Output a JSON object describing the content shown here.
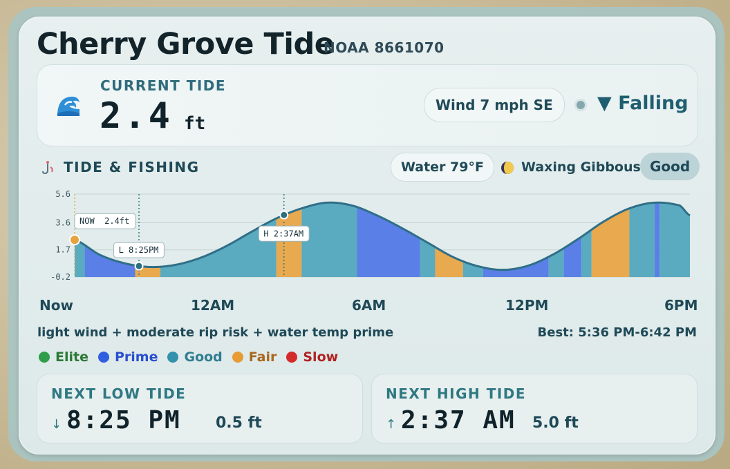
{
  "header": {
    "title": "Cherry Grove Tide",
    "station": "NOAA 8661070"
  },
  "current": {
    "label": "CURRENT TIDE",
    "value": "2.4",
    "unit": "ft",
    "wind": "Wind 7 mph SE",
    "trend": "▼ Falling"
  },
  "fishing": {
    "label": "TIDE & FISHING",
    "water": "Water 79°F",
    "moon": "Waxing Gibbous",
    "rating": "Good",
    "note": "light wind + moderate rip risk + water temp prime",
    "best": "Best: 5:36 PM-6:42 PM"
  },
  "legend": [
    {
      "label": "Elite",
      "color": "#2e9e4a"
    },
    {
      "label": "Prime",
      "color": "#2f5fe0"
    },
    {
      "label": "Good",
      "color": "#3391ab"
    },
    {
      "label": "Fair",
      "color": "#e69b34"
    },
    {
      "label": "Slow",
      "color": "#d22b2b"
    }
  ],
  "chart_data": {
    "type": "area",
    "y_ticks": [
      "5.6",
      "3.6",
      "1.7",
      "-0.2"
    ],
    "ylim": [
      -0.2,
      5.6
    ],
    "x_ticks": [
      {
        "label": "Now",
        "hours": 0
      },
      {
        "label": "12AM",
        "hours": 5.8
      },
      {
        "label": "6AM",
        "hours": 11.8
      },
      {
        "label": "12PM",
        "hours": 17.8
      },
      {
        "label": "6PM",
        "hours": 23.8
      }
    ],
    "xlim_hours": [
      0,
      24.4
    ],
    "tide_curve": [
      {
        "hours": 0.0,
        "ft": 2.4
      },
      {
        "hours": 1.0,
        "ft": 1.35
      },
      {
        "hours": 2.0,
        "ft": 0.75
      },
      {
        "hours": 3.0,
        "ft": 0.5
      },
      {
        "hours": 4.0,
        "ft": 0.65
      },
      {
        "hours": 5.0,
        "ft": 1.15
      },
      {
        "hours": 6.0,
        "ft": 1.95
      },
      {
        "hours": 7.0,
        "ft": 2.95
      },
      {
        "hours": 8.0,
        "ft": 3.9
      },
      {
        "hours": 9.0,
        "ft": 4.6
      },
      {
        "hours": 10.0,
        "ft": 5.0
      },
      {
        "hours": 11.0,
        "ft": 4.8
      },
      {
        "hours": 12.0,
        "ft": 4.1
      },
      {
        "hours": 13.0,
        "ft": 3.2
      },
      {
        "hours": 14.0,
        "ft": 2.2
      },
      {
        "hours": 15.0,
        "ft": 1.2
      },
      {
        "hours": 16.0,
        "ft": 0.55
      },
      {
        "hours": 17.0,
        "ft": 0.3
      },
      {
        "hours": 18.0,
        "ft": 0.6
      },
      {
        "hours": 19.0,
        "ft": 1.4
      },
      {
        "hours": 20.0,
        "ft": 2.5
      },
      {
        "hours": 21.0,
        "ft": 3.7
      },
      {
        "hours": 22.0,
        "ft": 4.6
      },
      {
        "hours": 23.0,
        "ft": 5.0
      },
      {
        "hours": 24.0,
        "ft": 4.8
      },
      {
        "hours": 24.4,
        "ft": 4.1
      }
    ],
    "rating_bands": [
      {
        "from": 0.0,
        "to": 0.4,
        "rating": "Good"
      },
      {
        "from": 0.4,
        "to": 2.4,
        "rating": "Prime"
      },
      {
        "from": 2.4,
        "to": 3.4,
        "rating": "Fair"
      },
      {
        "from": 3.4,
        "to": 8.0,
        "rating": "Good"
      },
      {
        "from": 8.0,
        "to": 9.0,
        "rating": "Fair"
      },
      {
        "from": 9.0,
        "to": 11.2,
        "rating": "Good"
      },
      {
        "from": 11.2,
        "to": 13.7,
        "rating": "Prime"
      },
      {
        "from": 13.7,
        "to": 14.3,
        "rating": "Good"
      },
      {
        "from": 14.3,
        "to": 15.4,
        "rating": "Fair"
      },
      {
        "from": 15.4,
        "to": 16.2,
        "rating": "Good"
      },
      {
        "from": 16.2,
        "to": 18.8,
        "rating": "Prime"
      },
      {
        "from": 18.8,
        "to": 19.4,
        "rating": "Good"
      },
      {
        "from": 19.4,
        "to": 20.1,
        "rating": "Prime"
      },
      {
        "from": 20.1,
        "to": 20.5,
        "rating": "Good"
      },
      {
        "from": 20.5,
        "to": 22.0,
        "rating": "Fair"
      },
      {
        "from": 22.0,
        "to": 23.0,
        "rating": "Good"
      },
      {
        "from": 23.0,
        "to": 23.2,
        "rating": "Prime"
      },
      {
        "from": 23.2,
        "to": 24.4,
        "rating": "Good"
      }
    ],
    "markers": [
      {
        "label": "NOW  2.4ft",
        "hours": 0.0,
        "ft": 2.4,
        "type": "now"
      },
      {
        "label": "L 8:25PM",
        "hours": 2.55,
        "ft": 0.5,
        "type": "low"
      },
      {
        "label": "H 2:37AM",
        "hours": 8.3,
        "ft": 5.0,
        "type": "high"
      }
    ]
  },
  "next_low": {
    "label": "NEXT LOW TIDE",
    "arrow": "↓",
    "time": "8:25 PM",
    "height": "0.5 ft"
  },
  "next_high": {
    "label": "NEXT HIGH TIDE",
    "arrow": "↑",
    "time": "2:37 AM",
    "height": "5.0 ft"
  }
}
